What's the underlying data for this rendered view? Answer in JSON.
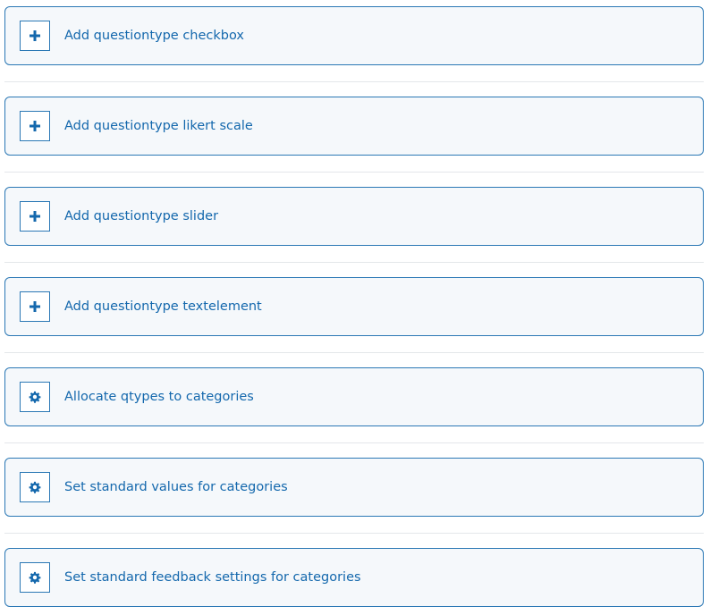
{
  "actions": [
    {
      "label": "Add questiontype checkbox",
      "icon": "plus-icon"
    },
    {
      "label": "Add questiontype likert scale",
      "icon": "plus-icon"
    },
    {
      "label": "Add questiontype slider",
      "icon": "plus-icon"
    },
    {
      "label": "Add questiontype textelement",
      "icon": "plus-icon"
    },
    {
      "label": "Allocate qtypes to categories",
      "icon": "gear-icon"
    },
    {
      "label": "Set standard values for categories",
      "icon": "gear-icon"
    },
    {
      "label": "Set standard feedback settings for categories",
      "icon": "gear-icon"
    }
  ],
  "colors": {
    "accent": "#1468ad",
    "border": "#2b78b5",
    "card_background": "#f5f8fb",
    "divider": "#e4e7ea"
  }
}
